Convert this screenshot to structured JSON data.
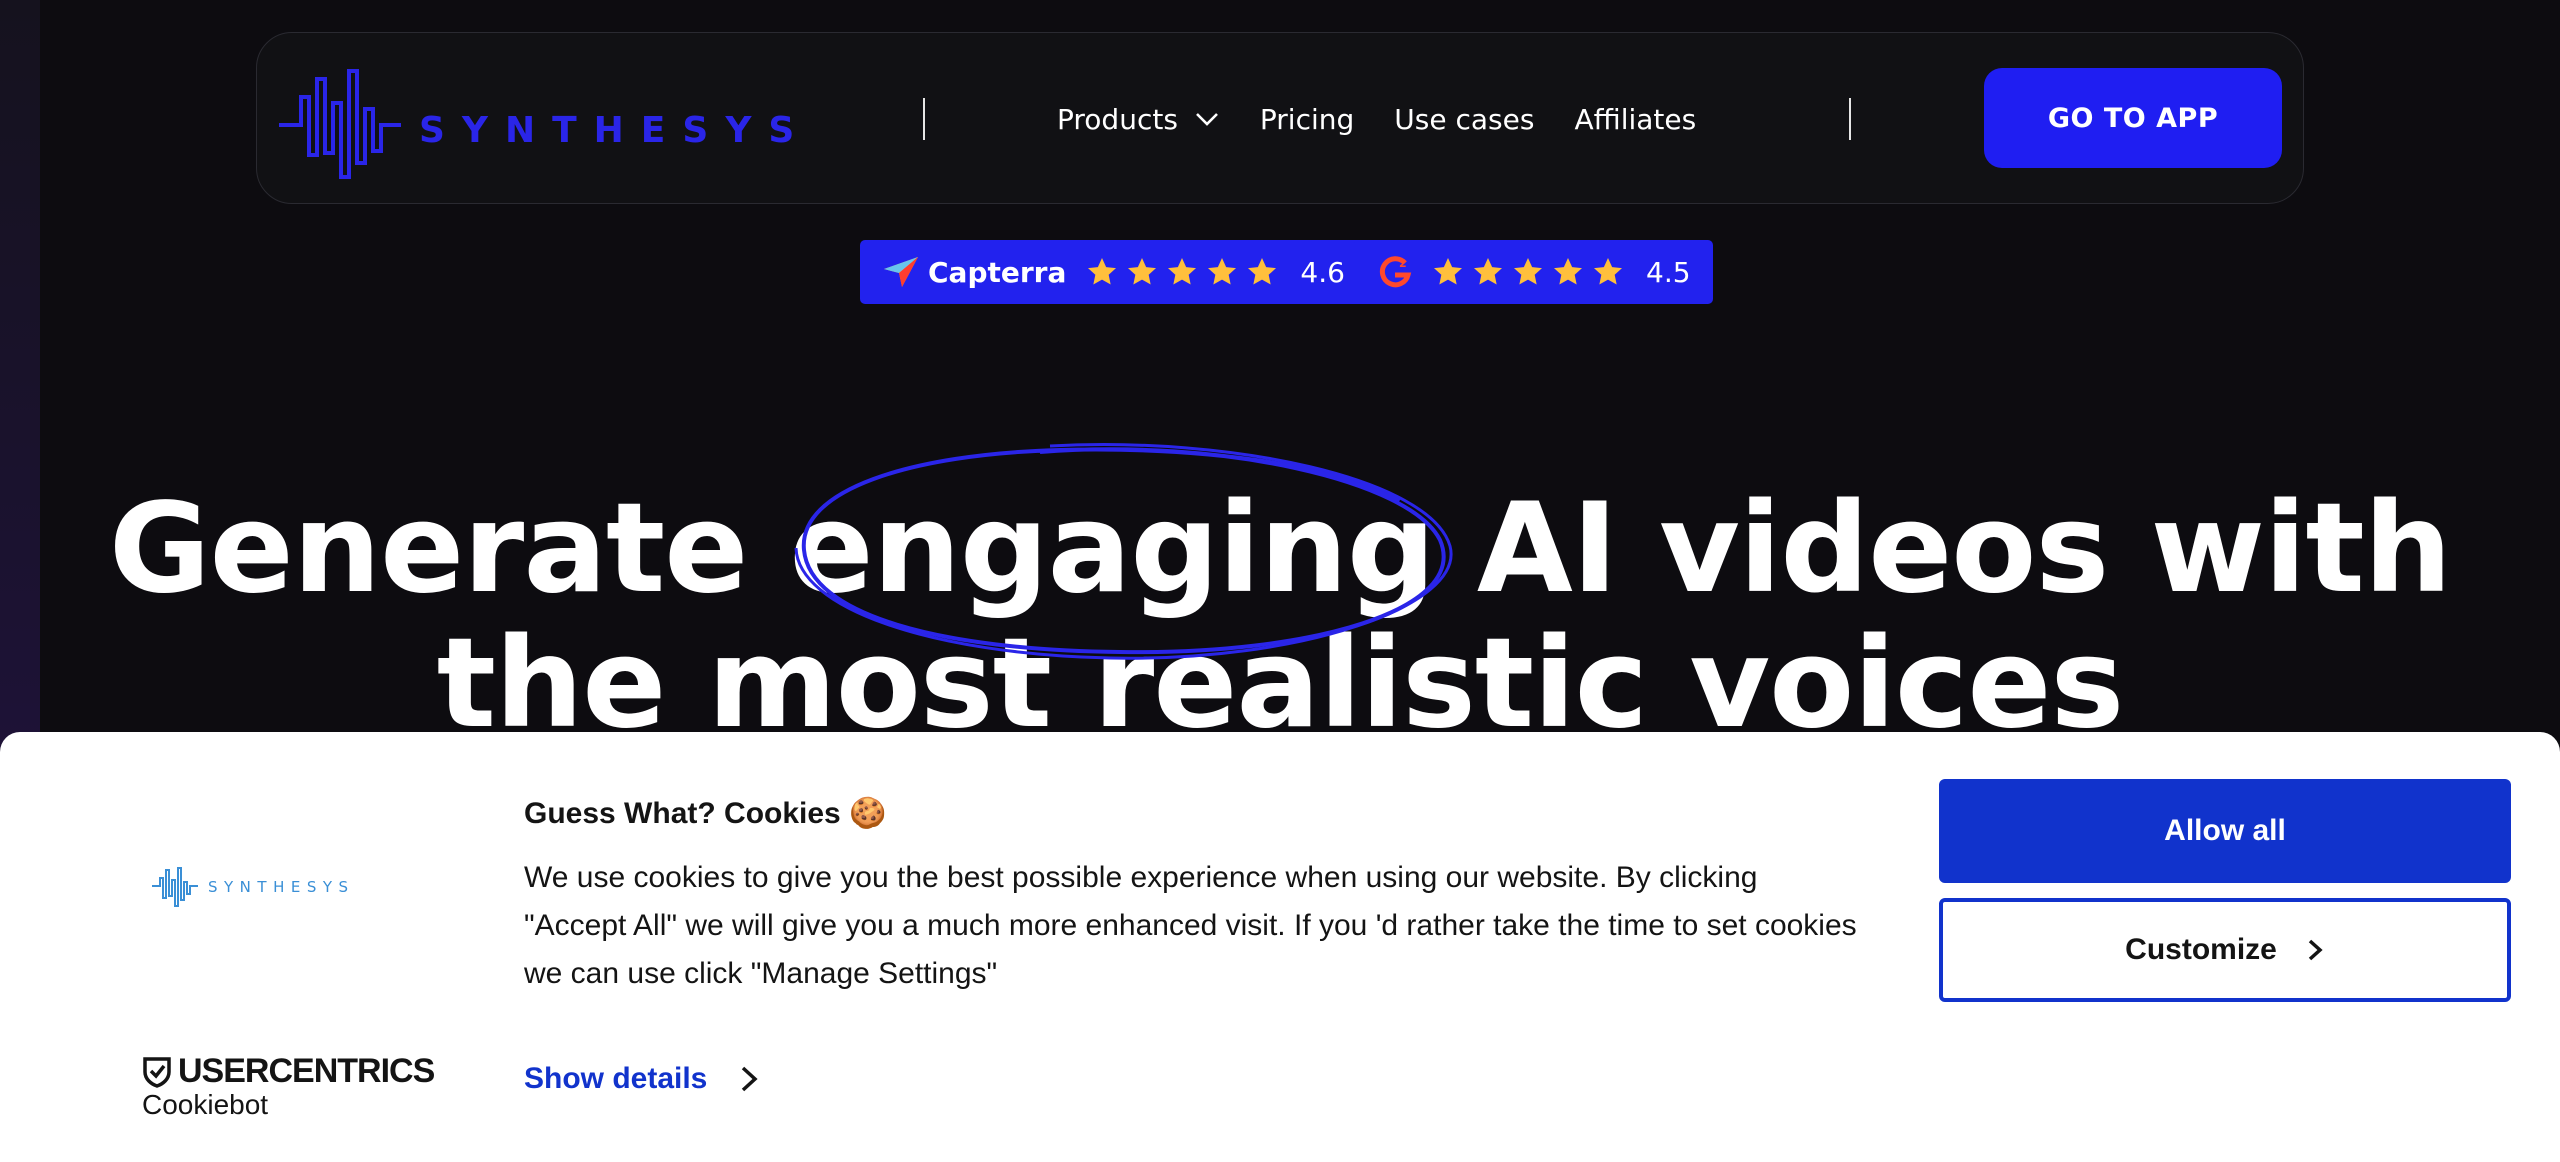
{
  "brand": {
    "name": "SYNTHESYS",
    "accent": "#1f1ef2"
  },
  "nav": {
    "links": [
      {
        "label": "Products",
        "has_dropdown": true,
        "icon": "chevron-down-icon"
      },
      {
        "label": "Pricing"
      },
      {
        "label": "Use cases"
      },
      {
        "label": "Affiliates"
      }
    ],
    "cta_label": "GO TO APP"
  },
  "ratings": [
    {
      "source": "Capterra",
      "icon": "capterra-logo-icon",
      "stars": 5,
      "value": "4.6"
    },
    {
      "source": "G2",
      "icon": "g2-logo-icon",
      "stars": 5,
      "value": "4.5"
    }
  ],
  "hero": {
    "line1": "Generate engaging AI videos with",
    "line2": "the most realistic voices",
    "highlight_word": "engaging"
  },
  "cookie_banner": {
    "logo_text": "SYNTHESYS",
    "title": "Guess What? Cookies 🍪",
    "body": "We use cookies to give you the best possible experience when using our website. By clicking \"Accept All\" we will give you a much more enhanced visit. If you 'd rather take the time to set cookies we can use click \"Manage Settings\"",
    "show_details_label": "Show details",
    "allow_all_label": "Allow all",
    "customize_label": "Customize",
    "provider_name": "USERCENTRICS",
    "provider_sub": "Cookiebot",
    "accent": "#1133cc"
  }
}
